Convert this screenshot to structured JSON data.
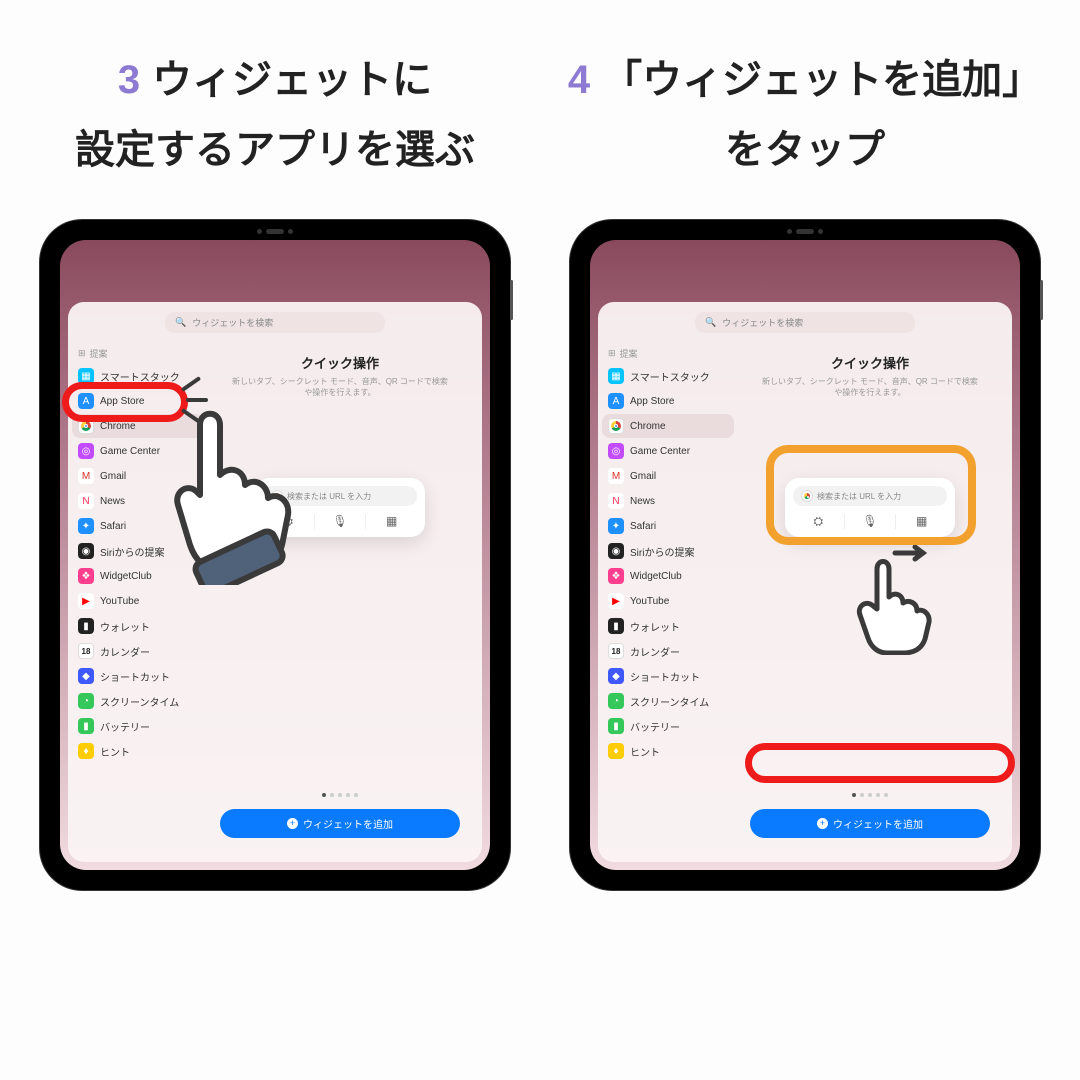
{
  "steps": {
    "s3": {
      "num": "3",
      "line1": "ウィジェットに",
      "line2": "設定するアプリを選ぶ"
    },
    "s4": {
      "num": "4",
      "line1": "「ウィジェットを追加」",
      "line2": "をタップ"
    }
  },
  "search_placeholder": "ウィジェットを検索",
  "sidebar_head": "提案",
  "apps": [
    {
      "label": "スマートスタック",
      "color": "#00c3ff",
      "glyph": "▦"
    },
    {
      "label": "App Store",
      "color": "#1e90ff",
      "glyph": "A"
    },
    {
      "label": "Chrome",
      "color": "#ffffff",
      "glyph": "",
      "chrome": true
    },
    {
      "label": "Game Center",
      "color": "#c24bff",
      "glyph": "◎"
    },
    {
      "label": "Gmail",
      "color": "#ffffff",
      "glyph": "M",
      "txt": "#d93025"
    },
    {
      "label": "News",
      "color": "#ffffff",
      "glyph": "N",
      "txt": "#ff2d55"
    },
    {
      "label": "Safari",
      "color": "#1e90ff",
      "glyph": "✦"
    },
    {
      "label": "Siriからの提案",
      "color": "#222",
      "glyph": "◉"
    },
    {
      "label": "WidgetClub",
      "color": "#ff3e8d",
      "glyph": "❖"
    },
    {
      "label": "YouTube",
      "color": "#ffffff",
      "glyph": "▶",
      "txt": "#ff0000"
    },
    {
      "label": "ウォレット",
      "color": "#222",
      "glyph": "▮"
    },
    {
      "label": "カレンダー",
      "color": "#ffffff",
      "glyph": "18",
      "txt": "#222"
    },
    {
      "label": "ショートカット",
      "color": "#3f58ff",
      "glyph": "◆"
    },
    {
      "label": "スクリーンタイム",
      "color": "#34c759",
      "glyph": "◔"
    },
    {
      "label": "バッテリー",
      "color": "#34c759",
      "glyph": "▮"
    },
    {
      "label": "ヒント",
      "color": "#ffcc00",
      "glyph": "♦"
    }
  ],
  "main": {
    "title": "クイック操作",
    "sub": "新しいタブ、シークレット モード、音声、QR コードで検索や操作を行えます。"
  },
  "widget": {
    "search": "検索または URL を入力",
    "icons": [
      "👓",
      "🎤",
      "⌘"
    ]
  },
  "add_button": "ウィジェットを追加"
}
